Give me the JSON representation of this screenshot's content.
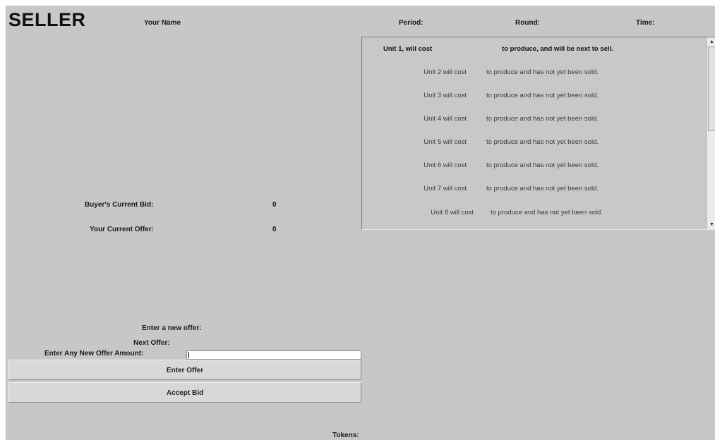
{
  "header": {
    "role": "SELLER",
    "your_name_label": "Your Name",
    "period_label": "Period:",
    "round_label": "Round:",
    "time_label": "Time:"
  },
  "market": {
    "buyer_bid_label": "Buyer's Current Bid:",
    "buyer_bid_value": "0",
    "your_offer_label": "Your Current Offer:",
    "your_offer_value": "0"
  },
  "units": [
    {
      "label": "Unit 1, will cost",
      "text": "to produce, and will be next to sell."
    },
    {
      "label": "Unit 2 will cost",
      "text": "to produce and has not yet been sold."
    },
    {
      "label": "Unit 3 will cost",
      "text": "to produce and has not yet been sold."
    },
    {
      "label": "Unit 4 will cost",
      "text": "to produce and has not yet been sold."
    },
    {
      "label": "Unit 5 will cost",
      "text": "to produce and has not yet been sold."
    },
    {
      "label": "Unit 6 will cost",
      "text": "to produce and has not yet been sold."
    },
    {
      "label": "Unit 7 will cost",
      "text": "to produce and has not yet been sold."
    },
    {
      "label": "Unit 8 will cost",
      "text": "to produce and has not yet been sold."
    }
  ],
  "offer_form": {
    "enter_new_offer_label": "Enter a new offer:",
    "next_offer_label": "Next Offer:",
    "amount_label": "Enter Any New Offer Amount:",
    "amount_value": "",
    "enter_offer_button": "Enter Offer",
    "accept_bid_button": "Accept Bid"
  },
  "footer": {
    "tokens_label": "Tokens:"
  },
  "icons": {
    "scroll_up": "scroll-up-arrow-icon",
    "scroll_down": "scroll-down-arrow-icon"
  }
}
